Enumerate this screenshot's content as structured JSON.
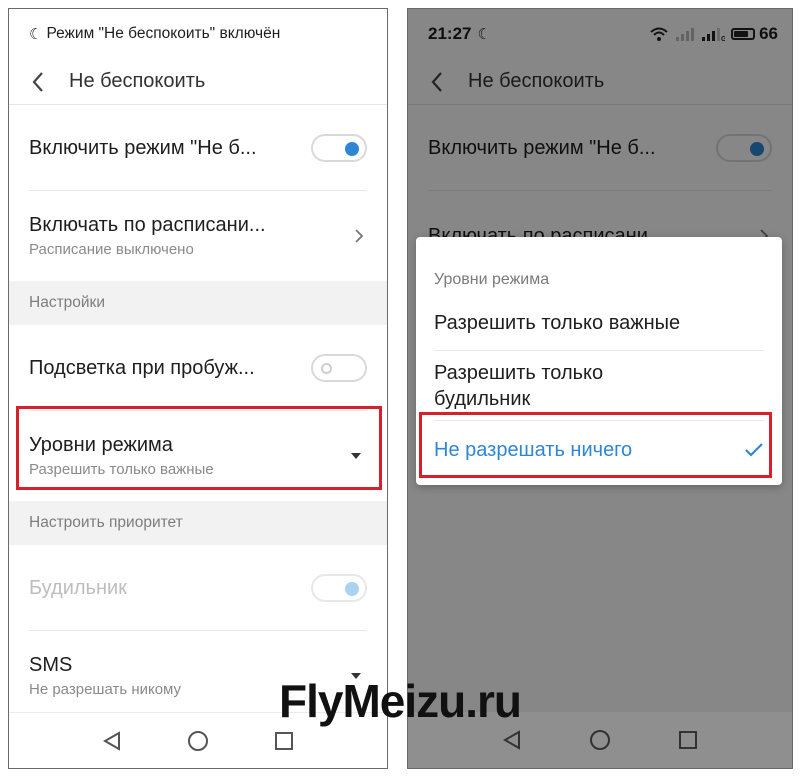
{
  "left": {
    "status_text": "Режим \"Не беспокоить\" включён",
    "toolbar_title": "Не беспокоить",
    "rows": {
      "enable_label": "Включить режим \"Не б...",
      "schedule_label": "Включать по расписани...",
      "schedule_sub": "Расписание выключено",
      "settings_header": "Настройки",
      "wake_label": "Подсветка при пробуж...",
      "levels_label": "Уровни режима",
      "levels_sub": "Разрешить только важные",
      "priority_header": "Настроить приоритет",
      "alarm_label": "Будильник",
      "sms_label": "SMS",
      "sms_sub": "Не разрешать никому"
    }
  },
  "right": {
    "status_time": "21:27",
    "battery_level": "66",
    "toolbar_title": "Не беспокоить",
    "rows": {
      "enable_label": "Включить режим \"Не б...",
      "schedule_label": "Включать по расписани..."
    },
    "dialog": {
      "title": "Уровни режима",
      "option1": "Разрешить только важные",
      "option2_line1": "Разрешить только",
      "option2_line2": "будильник",
      "option3": "Не разрешать ничего",
      "selected": "option3"
    }
  },
  "watermark": "FlyMeizu.ru",
  "colors": {
    "accent": "#2f86d6",
    "highlight": "#d7202a"
  }
}
